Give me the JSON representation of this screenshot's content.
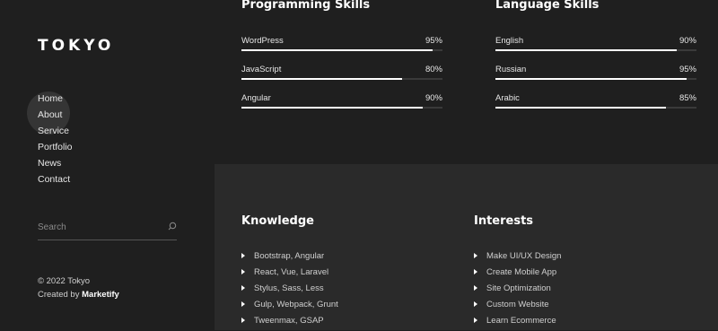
{
  "sidebar": {
    "logo": "TOKYO",
    "nav": [
      "Home",
      "About",
      "Service",
      "Portfolio",
      "News",
      "Contact"
    ],
    "search_placeholder": "Search",
    "copyright": "© 2022 Tokyo",
    "created_by_label": "Created by",
    "created_by_brand": "Marketify"
  },
  "programming": {
    "title": "Programming Skills",
    "skills": [
      {
        "name": "WordPress",
        "percent": "95%",
        "value": 95
      },
      {
        "name": "JavaScript",
        "percent": "80%",
        "value": 80
      },
      {
        "name": "Angular",
        "percent": "90%",
        "value": 90
      }
    ]
  },
  "language": {
    "title": "Language Skills",
    "skills": [
      {
        "name": "English",
        "percent": "90%",
        "value": 90
      },
      {
        "name": "Russian",
        "percent": "95%",
        "value": 95
      },
      {
        "name": "Arabic",
        "percent": "85%",
        "value": 85
      }
    ]
  },
  "knowledge": {
    "title": "Knowledge",
    "items": [
      "Bootstrap, Angular",
      "React, Vue, Laravel",
      "Stylus, Sass, Less",
      "Gulp, Webpack, Grunt",
      "Tweenmax, GSAP"
    ]
  },
  "interests": {
    "title": "Interests",
    "items": [
      "Make UI/UX Design",
      "Create Mobile App",
      "Site Optimization",
      "Custom Website",
      "Learn Ecommerce"
    ]
  },
  "colors": {
    "background": "#1f1f1f",
    "lower_background": "#2a2a2a",
    "bar_fill": "#ffffff",
    "bar_track": "#3a3a3a"
  }
}
